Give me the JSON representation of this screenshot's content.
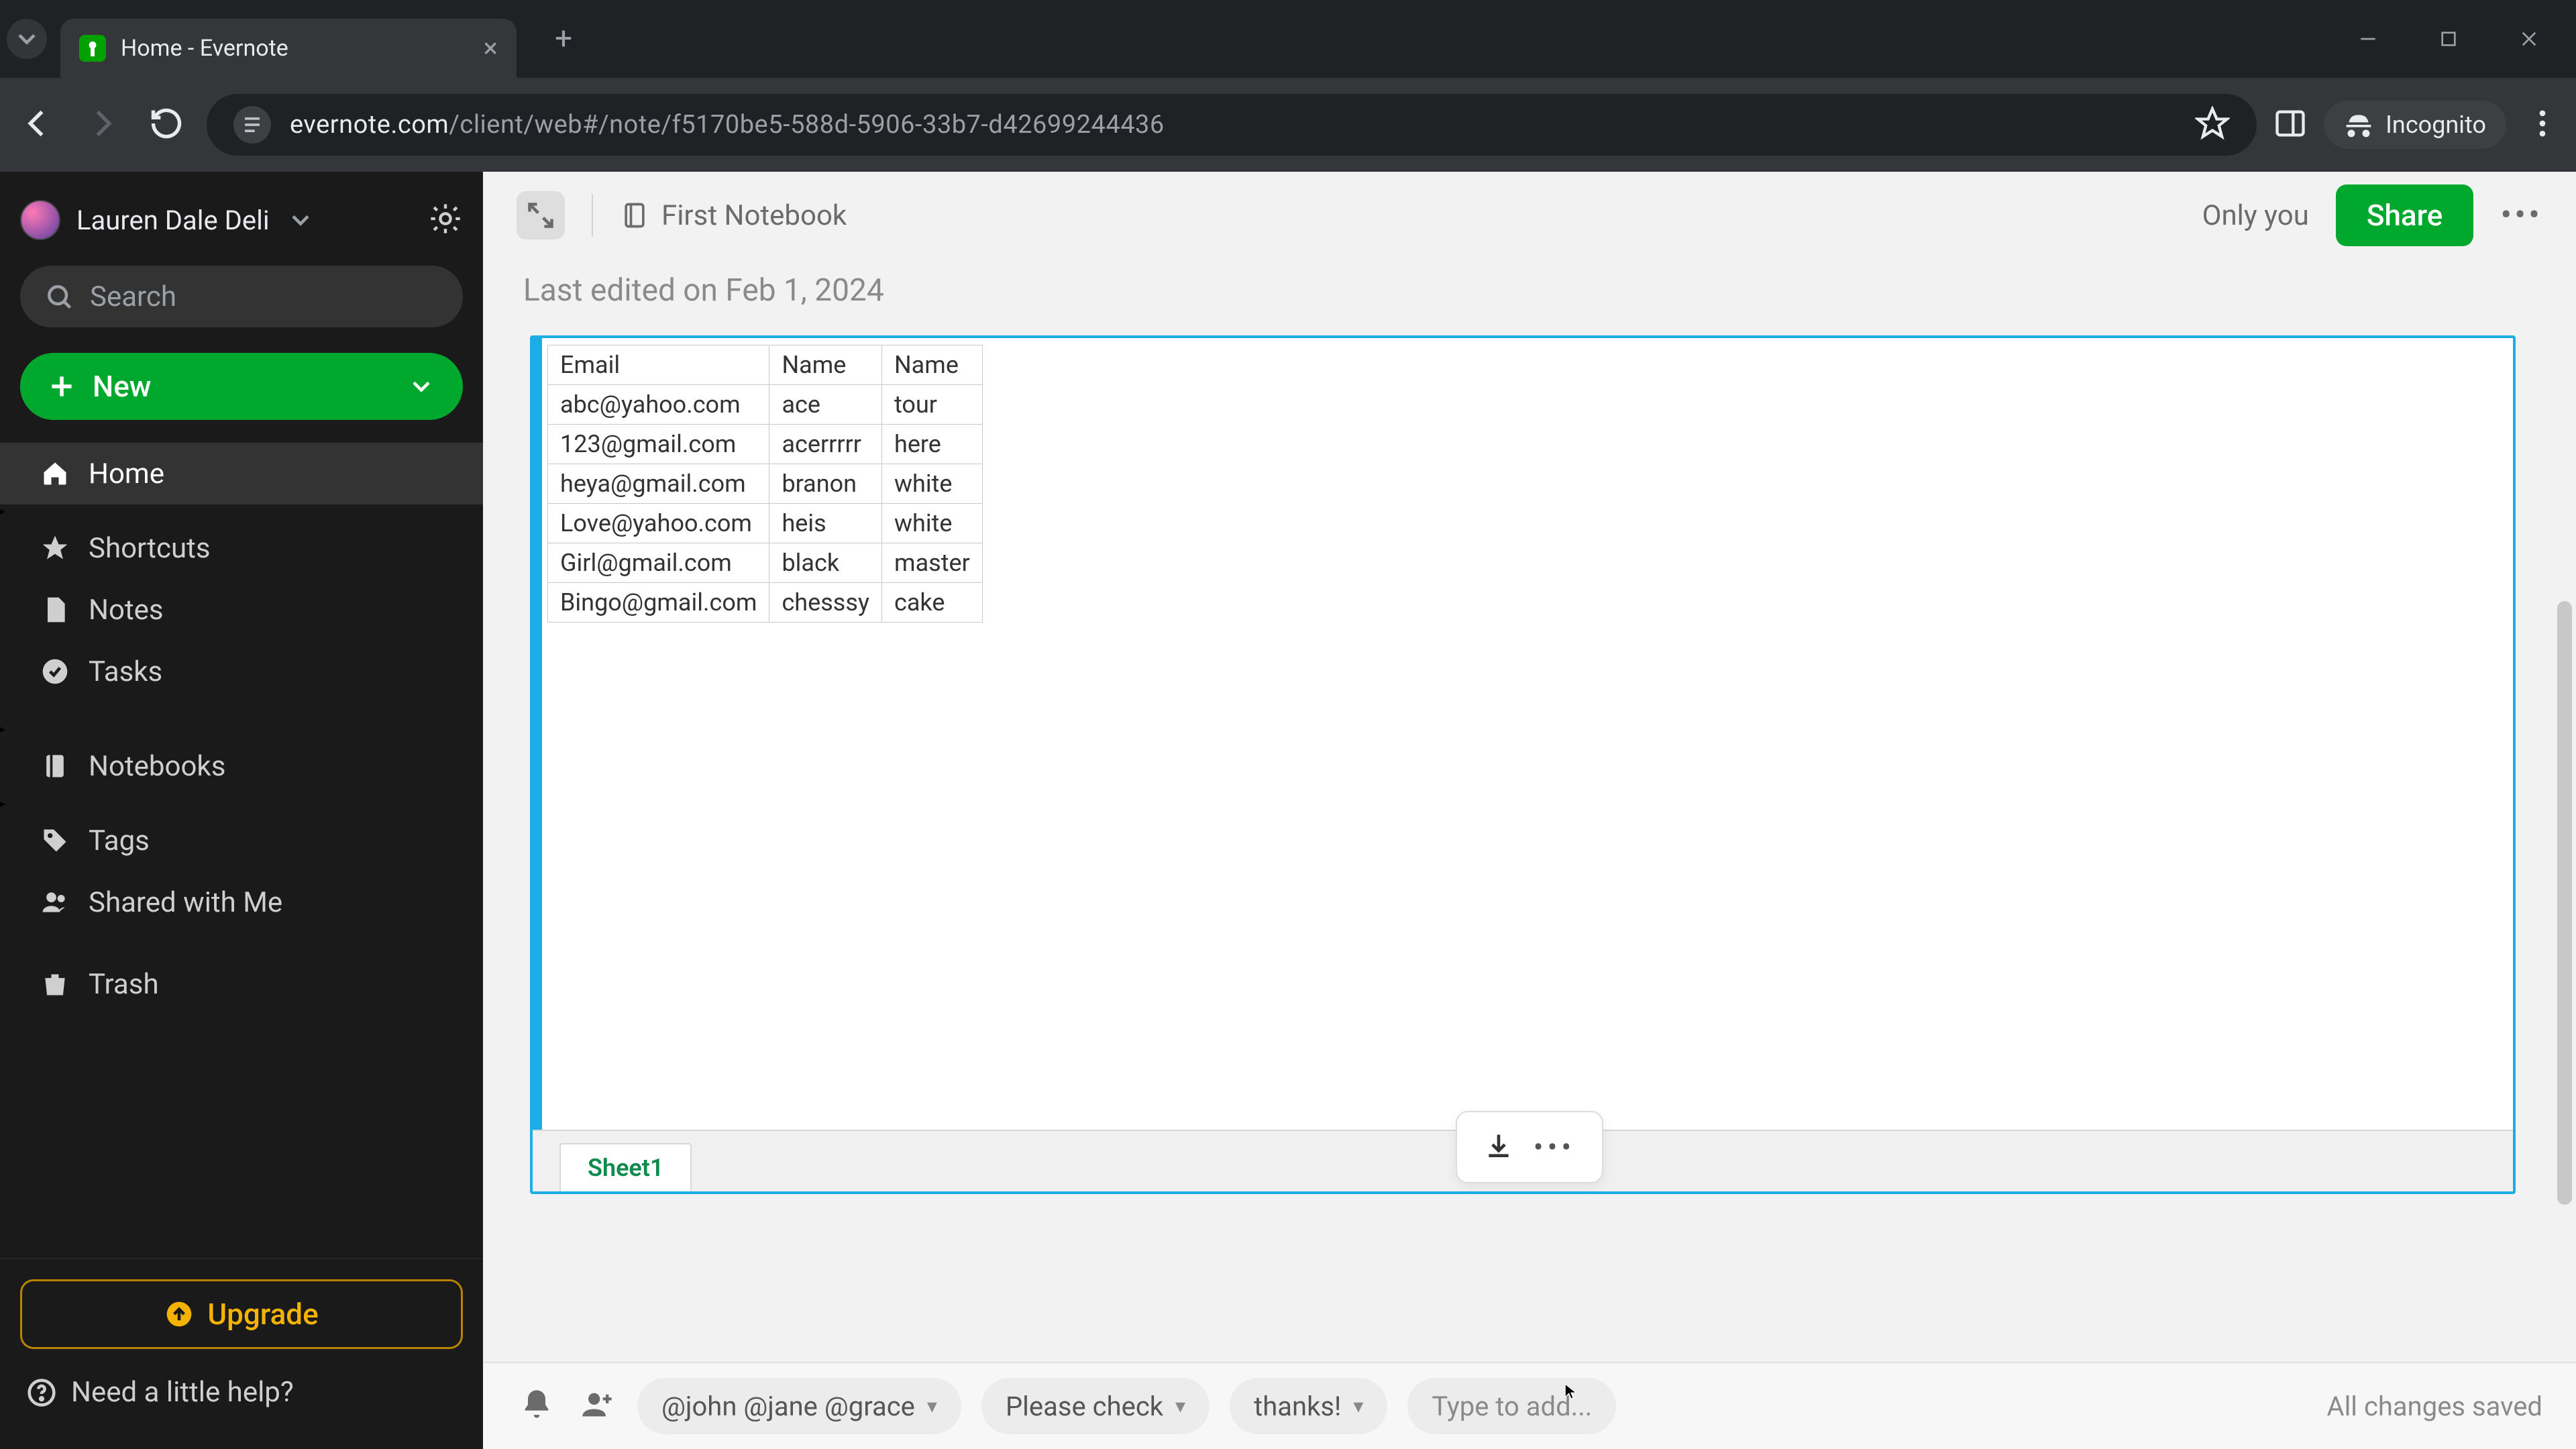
{
  "browser": {
    "tab_title": "Home - Evernote",
    "url_host": "evernote.com",
    "url_path": "/client/web#/note/f5170be5-588d-5906-33b7-d42699244436",
    "incognito_label": "Incognito"
  },
  "sidebar": {
    "username": "Lauren Dale Deli",
    "search_placeholder": "Search",
    "new_label": "New",
    "items": {
      "home": "Home",
      "shortcuts": "Shortcuts",
      "notes": "Notes",
      "tasks": "Tasks",
      "notebooks": "Notebooks",
      "tags": "Tags",
      "shared": "Shared with Me",
      "trash": "Trash"
    },
    "upgrade_label": "Upgrade",
    "help_label": "Need a little help?"
  },
  "header": {
    "notebook": "First Notebook",
    "only_you": "Only you",
    "share": "Share"
  },
  "note": {
    "last_edited": "Last edited on Feb 1, 2024",
    "sheet_tab": "Sheet1",
    "table": {
      "headers": [
        "Email",
        "Name",
        "Name"
      ],
      "rows": [
        [
          "abc@yahoo.com",
          "ace",
          "tour"
        ],
        [
          "123@gmail.com",
          "acerrrrr",
          "here"
        ],
        [
          "heya@gmail.com",
          "branon",
          "white"
        ],
        [
          "Love@yahoo.com",
          "heis",
          "white"
        ],
        [
          "Girl@gmail.com",
          "black",
          "master"
        ],
        [
          "Bingo@gmail.com",
          "chesssy",
          "cake"
        ]
      ]
    }
  },
  "footer": {
    "chip_mentions": "@john @jane @grace",
    "chip_check": "Please check",
    "chip_thanks": "thanks!",
    "type_placeholder": "Type to add...",
    "save_status": "All changes saved"
  }
}
